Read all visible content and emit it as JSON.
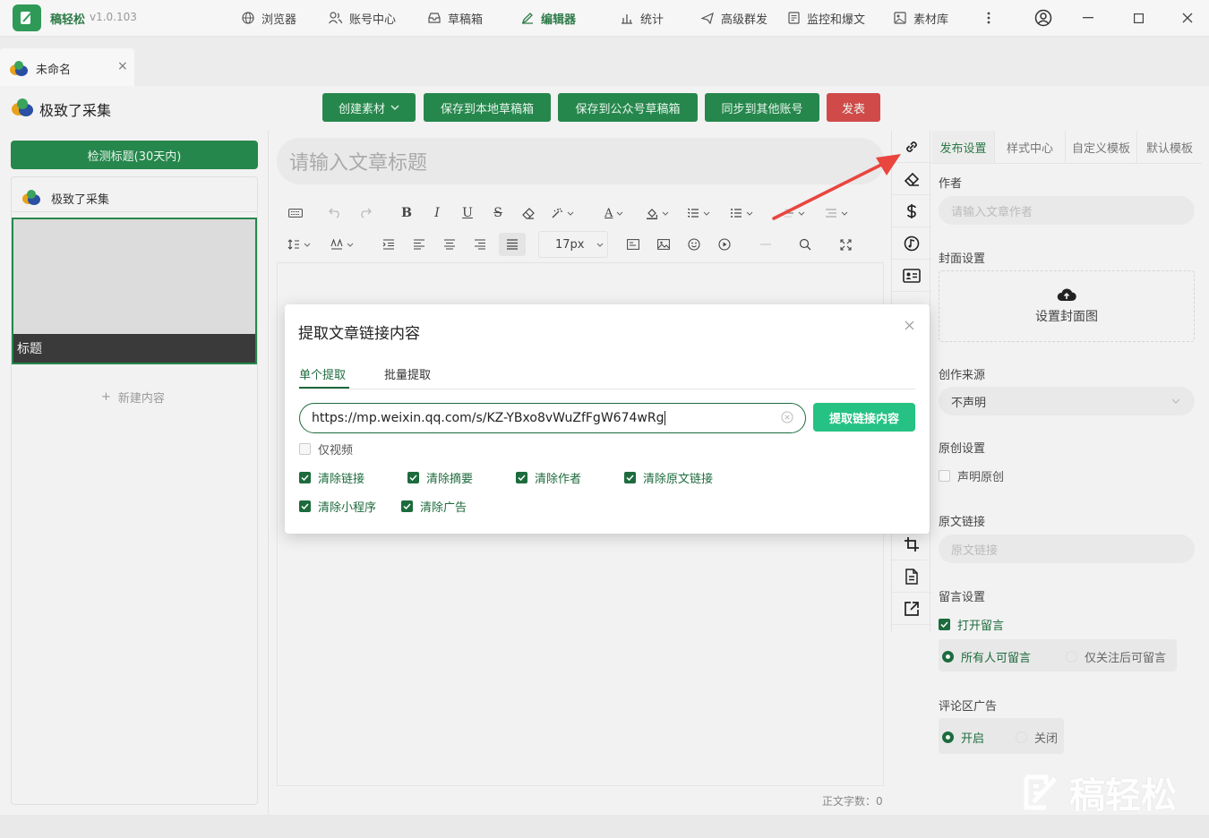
{
  "app": {
    "name": "稿轻松",
    "version": "v1.0.103"
  },
  "nav": [
    {
      "label": "浏览器",
      "icon": "globe-icon"
    },
    {
      "label": "账号中心",
      "icon": "users-icon"
    },
    {
      "label": "草稿箱",
      "icon": "inbox-icon"
    },
    {
      "label": "编辑器",
      "icon": "pen-icon",
      "active": true
    },
    {
      "label": "统计",
      "icon": "bar-chart-icon"
    },
    {
      "label": "高级群发",
      "icon": "send-icon"
    },
    {
      "label": "监控和爆文",
      "icon": "monitor-icon"
    },
    {
      "label": "素材库",
      "icon": "image-icon"
    }
  ],
  "doc_tab": {
    "label": "未命名",
    "close": "×"
  },
  "account": {
    "name": "极致了采集"
  },
  "actions": {
    "create_material": "创建素材",
    "save_local": "保存到本地草稿箱",
    "save_mp": "保存到公众号草稿箱",
    "sync": "同步到其他账号",
    "publish": "发表"
  },
  "left": {
    "detect_button": "检测标题(30天内)",
    "account_name": "极致了采集",
    "card_title": "标题",
    "new_content": "新建内容"
  },
  "editor": {
    "title_placeholder": "请输入文章标题",
    "font_size": "17px",
    "word_count": "正文字数：0"
  },
  "settings": {
    "tabs": [
      "发布设置",
      "样式中心",
      "自定义模板",
      "默认模板"
    ],
    "author_label": "作者",
    "author_placeholder": "请输入文章作者",
    "cover_label": "封面设置",
    "cover_button": "设置封面图",
    "source_label": "创作来源",
    "source_value": "不声明",
    "original_label": "原创设置",
    "original_checkbox": "声明原创",
    "original_link_label": "原文链接",
    "original_link_placeholder": "原文链接",
    "comment_label": "留言设置",
    "comment_open": "打开留言",
    "comment_all": "所有人可留言",
    "comment_followers": "仅关注后可留言",
    "ad_label": "评论区广告",
    "ad_on": "开启",
    "ad_off": "关闭"
  },
  "modal": {
    "title": "提取文章链接内容",
    "tab_single": "单个提取",
    "tab_batch": "批量提取",
    "url_value": "https://mp.weixin.qq.com/s/KZ-YBxo8vWuZfFgW674wRg",
    "extract_button": "提取链接内容",
    "video_only": "仅视频",
    "options": [
      {
        "label": "清除链接",
        "checked": true
      },
      {
        "label": "清除摘要",
        "checked": true
      },
      {
        "label": "清除作者",
        "checked": true
      },
      {
        "label": "清除原文链接",
        "checked": true
      },
      {
        "label": "清除小程序",
        "checked": true
      },
      {
        "label": "清除广告",
        "checked": true
      }
    ]
  },
  "watermark": "稿轻松",
  "colors": {
    "brand_green": "#26874c",
    "dark_green": "#1d6b3d",
    "accent_green": "#25c283",
    "publish_red": "#d14a4a",
    "annotation_red": "#e8463f"
  }
}
